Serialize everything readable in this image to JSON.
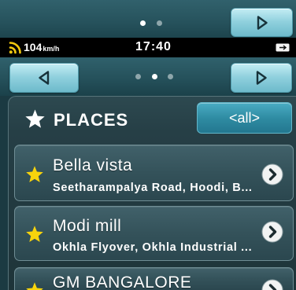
{
  "top_strip": {
    "page_dots": {
      "count": 2,
      "active": 0
    },
    "next_button_icon": "right-arrow-icon"
  },
  "status_bar": {
    "gps_icon": "gps-signal-icon",
    "speed": "104",
    "speed_unit": "km/h",
    "time": "17:40",
    "power_icon": "battery-icon"
  },
  "nav_row": {
    "prev_button_icon": "left-arrow-icon",
    "next_button_icon": "right-arrow-icon",
    "page_dots": {
      "count": 3,
      "active": 1
    }
  },
  "places": {
    "title_icon": "star-icon",
    "title": "PLACES",
    "filter_button": "<all>",
    "items": [
      {
        "name": "Bella vista",
        "address": "Seetharampalya Road, Hoodi, B...",
        "icon": "star-icon",
        "action_icon": "chevron-right-circle-icon"
      },
      {
        "name": "Modi mill",
        "address": "Okhla Flyover, Okhla Industrial ...",
        "icon": "star-icon",
        "action_icon": "chevron-right-circle-icon"
      },
      {
        "name": "GM BANGALORE",
        "icon": "star-icon",
        "action_icon": "chevron-right-circle-icon"
      }
    ]
  },
  "colors": {
    "favorite_star": "#f7d40c",
    "filter_button": "#2f8ca3",
    "nav_button": "#8fd0dd",
    "status_bar": "#000000",
    "panel": "#263f46"
  }
}
